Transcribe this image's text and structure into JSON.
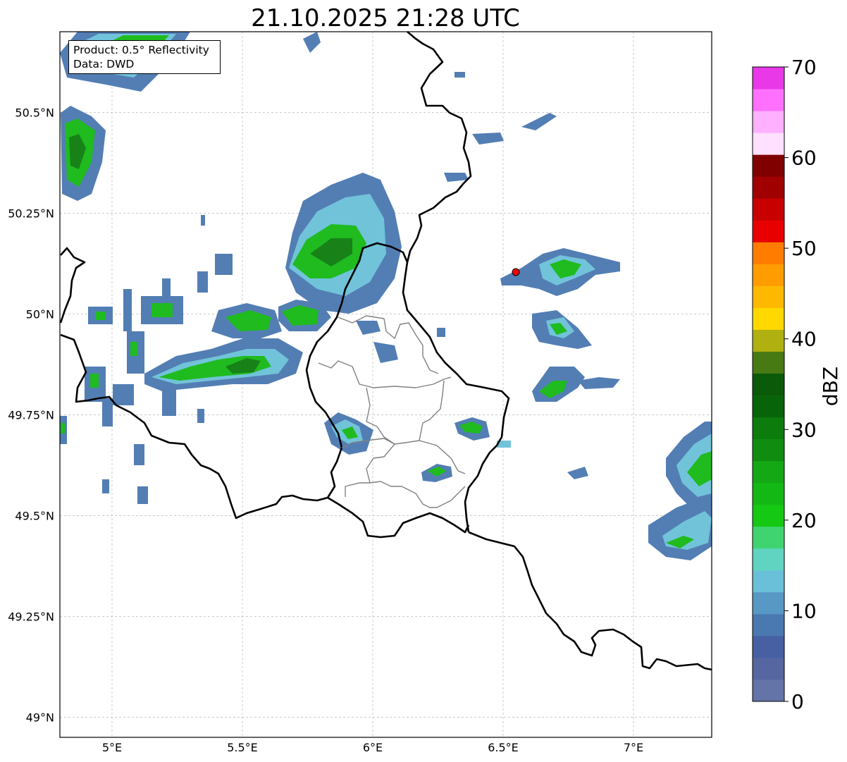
{
  "title": "21.10.2025 21:28 UTC",
  "info": {
    "product": "Product: 0.5° Reflectivity",
    "source": "Data: DWD"
  },
  "axes": {
    "lon_ticks": [
      "5°E",
      "5.5°E",
      "6°E",
      "6.5°E",
      "7°E"
    ],
    "lat_ticks": [
      "50.5°N",
      "50.25°N",
      "50°N",
      "49.75°N",
      "49.5°N",
      "49.25°N",
      "49°N"
    ],
    "lon_range": [
      4.8,
      7.3
    ],
    "lat_range": [
      48.95,
      50.7
    ],
    "gridlines": true
  },
  "colorbar": {
    "label": "dBZ",
    "tick_labels": [
      "0",
      "10",
      "20",
      "30",
      "40",
      "50",
      "60",
      "70"
    ],
    "range": [
      0,
      70
    ],
    "colors": [
      "#6474a8",
      "#5566a0",
      "#4760a4",
      "#4a78b0",
      "#5898c4",
      "#6ac0d8",
      "#60d4c0",
      "#40d470",
      "#14c814",
      "#14b814",
      "#14a814",
      "#108c10",
      "#0c7c0c",
      "#086408",
      "#0a5a0a",
      "#487a14",
      "#b0b010",
      "#ffd800",
      "#ffb800",
      "#ff9c00",
      "#ff7c00",
      "#e80000",
      "#c80000",
      "#a00000",
      "#800000",
      "#ffe0ff",
      "#ffb0ff",
      "#ff70ff",
      "#e838e8"
    ]
  },
  "marker": {
    "name": "radar site",
    "color": "#ff0000"
  }
}
